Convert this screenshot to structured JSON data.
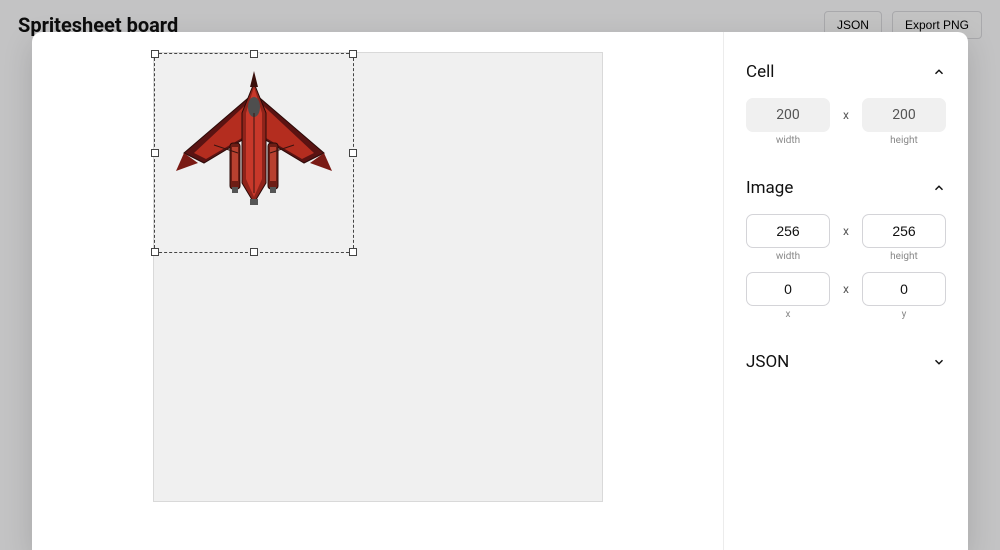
{
  "app": {
    "title": "Spritesheet board"
  },
  "toolbar": {
    "json_label": "JSON",
    "export_label": "Export PNG"
  },
  "sep": {
    "x": "x"
  },
  "panel": {
    "cell": {
      "title": "Cell",
      "expanded": true,
      "width": "200",
      "height": "200",
      "width_label": "width",
      "height_label": "height"
    },
    "image": {
      "title": "Image",
      "expanded": true,
      "width": "256",
      "height": "256",
      "width_label": "width",
      "height_label": "height",
      "x": "0",
      "y": "0",
      "x_label": "x",
      "y_label": "y"
    },
    "json": {
      "title": "JSON",
      "expanded": false
    }
  }
}
